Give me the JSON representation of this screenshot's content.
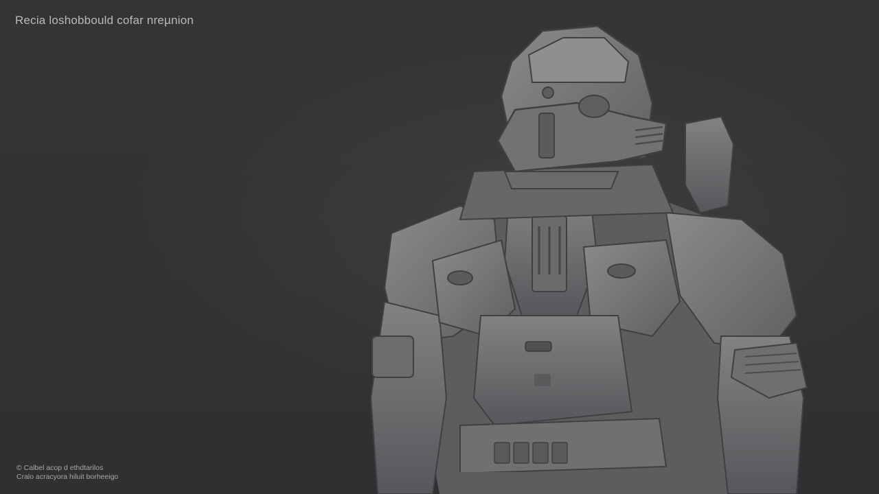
{
  "header": {
    "title": "Recia loshobbould cofar nreµnion"
  },
  "footer": {
    "line1": "© Calbel acop d ethdtarilos",
    "line2": "Cralo acracyora hiluit borheeigo"
  },
  "colors": {
    "background": "#313233",
    "armor": "#7d7e7f",
    "armor_shadow": "#4a4b4c",
    "text": "#b9babb"
  },
  "render": {
    "subject": "sculpted-armored-soldier"
  }
}
